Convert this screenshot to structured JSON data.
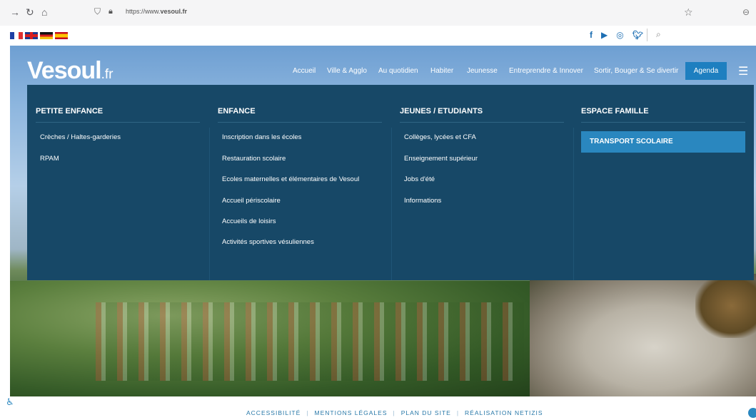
{
  "browser": {
    "url": "https://www.vesoul.fr",
    "url_prefix": "https://www.",
    "url_domain": "vesoul.fr"
  },
  "topbar": {
    "languages": [
      "fr",
      "gb",
      "de",
      "es"
    ],
    "social_icons": [
      "facebook-icon",
      "youtube-icon",
      "instagram-icon",
      "twitter-icon"
    ]
  },
  "header": {
    "logo_main": "Vesoul",
    "logo_suffix": ".fr",
    "nav": [
      "Accueil",
      "Ville & Agglo",
      "Au quotidien",
      "Habiter",
      "Jeunesse",
      "Entreprendre & Innover",
      "Sortir, Bouger & Se divertir"
    ],
    "agenda_label": "Agenda"
  },
  "mega_menu": {
    "columns": [
      {
        "title": "PETITE ENFANCE",
        "items": [
          "Crèches / Haltes-garderies",
          "RPAM"
        ]
      },
      {
        "title": "ENFANCE",
        "items": [
          "Inscription dans les écoles",
          "Restauration scolaire",
          "Ecoles maternelles et élémentaires de Vesoul",
          "Accueil périscolaire",
          "Accueils de loisirs",
          "Activités sportives vésuliennes"
        ]
      },
      {
        "title": "JEUNES / ETUDIANTS",
        "items": [
          "Collèges, lycées et CFA",
          "Enseignement supérieur",
          "Jobs d'été",
          "Informations"
        ]
      },
      {
        "title": "ESPACE FAMILLE",
        "items": [
          "TRANSPORT SCOLAIRE"
        ]
      }
    ]
  },
  "footer": {
    "links": [
      "ACCESSIBILITÉ",
      "MENTIONS LÉGALES",
      "PLAN DU SITE",
      "RÉALISATION NETIZIS"
    ]
  },
  "colors": {
    "menu_bg": "#174867",
    "accent": "#2a87bf"
  }
}
